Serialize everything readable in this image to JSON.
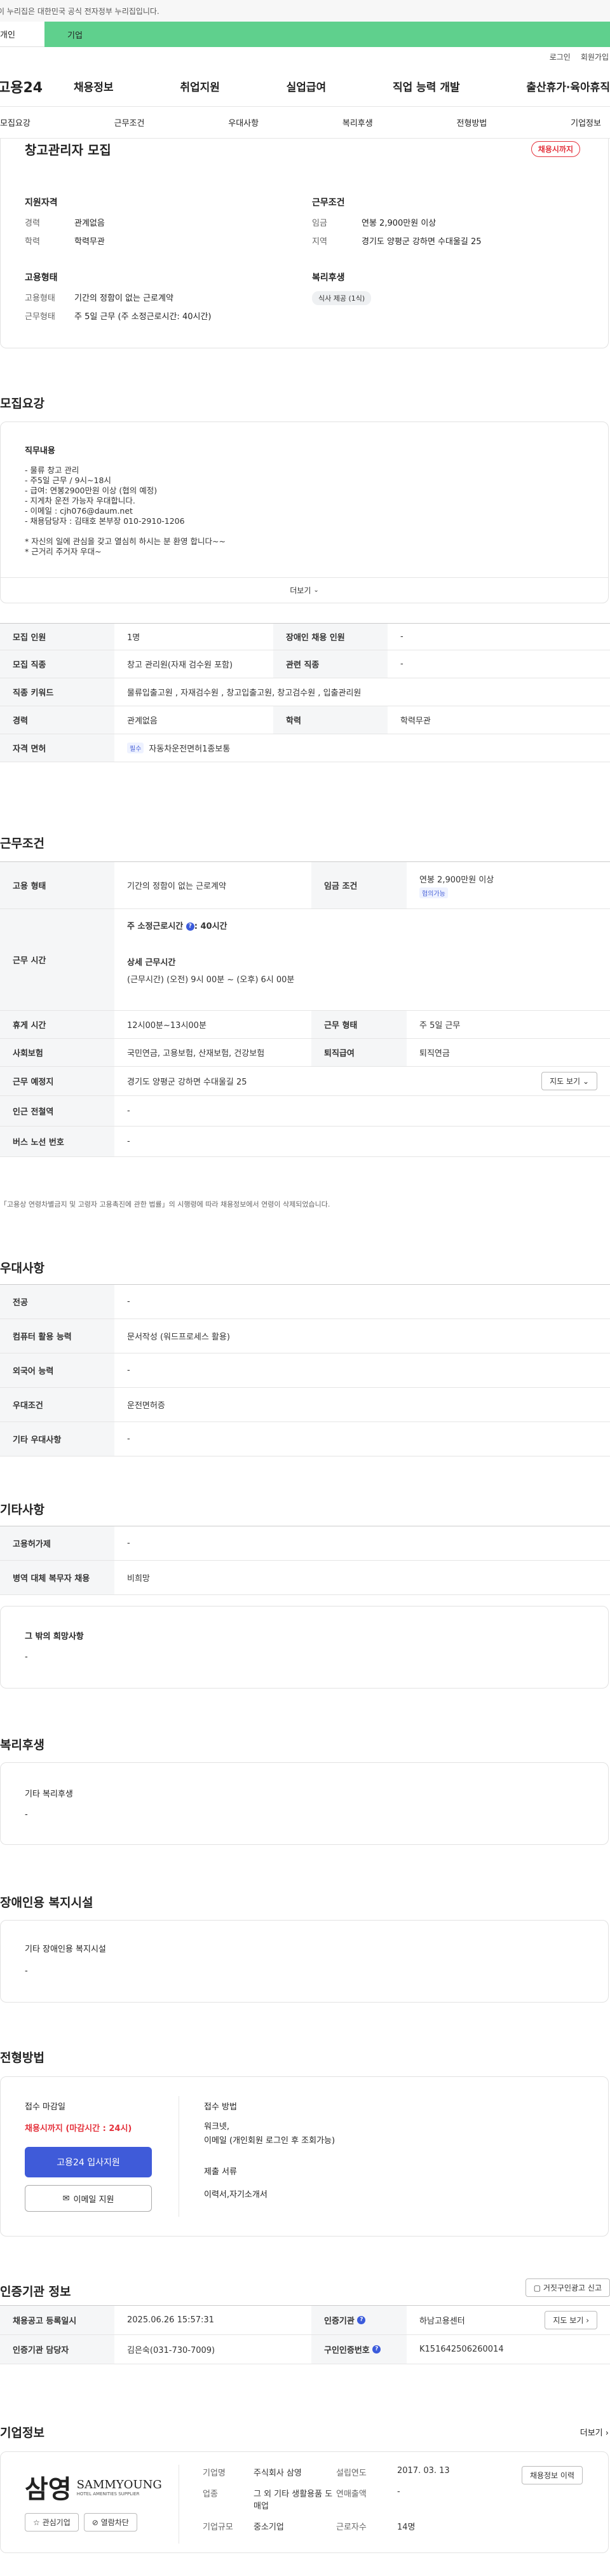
{
  "gov_banner": "이 누리집은 대한민국 공식 전자정부 누리집입니다.",
  "top_tabs": [
    "개인",
    "기업"
  ],
  "util": [
    "로그인",
    "회원가입"
  ],
  "logo": "고용24",
  "gnb": [
    "채용정보",
    "취업지원",
    "실업급여",
    "직업 능력 개발",
    "출산휴가·육아휴직"
  ],
  "subnav": [
    "모집요강",
    "근무조건",
    "우대사항",
    "복리후생",
    "전형방법",
    "기업정보"
  ],
  "summary": {
    "title": "창고관리자 모집",
    "status_badge": "채용시까지",
    "qualification": {
      "heading": "지원자격",
      "career_k": "경력",
      "career_v": "관계없음",
      "edu_k": "학력",
      "edu_v": "학력무관"
    },
    "employment": {
      "heading": "고용형태",
      "type_k": "고용형태",
      "type_v": "기간의 정함이 없는 근로계약",
      "hours_k": "근무형태",
      "hours_v": "주 5일 근무 (주 소정근로시간: 40시간)"
    },
    "conditions": {
      "heading": "근무조건",
      "wage_k": "임금",
      "wage_v": "연봉 2,900만원 이상",
      "loc_k": "지역",
      "loc_v": "경기도 양평군 강하면 수대울길 25"
    },
    "welfare": {
      "heading": "복리후생",
      "pill": "식사 제공 (1식)"
    }
  },
  "recruit": {
    "title": "모집요강",
    "duty_heading": "직무내용",
    "duty_lines": [
      "- 물류 창고 관리",
      "- 주5일 근무 / 9시~18시",
      "- 급여: 연봉2900만원 이상 (협의 예정)",
      "- 지게차 운전 가능자 우대합니다.",
      "- 이메일 : cjh076@daum.net",
      "- 채용담당자 : 김태호 본부장  010-2910-1206",
      "",
      "* 자신의 일에 관심을 갖고 열심히 하시는 분 환영 합니다~~",
      "* 근거리 주거자 우대~"
    ],
    "more": "더보기",
    "rows": [
      {
        "k1": "모집 인원",
        "v1": "1명",
        "k2": "장애인 채용 인원",
        "v2": "-"
      },
      {
        "k1": "모집 직종",
        "v1": "창고 관리원(자재 검수원 포함)",
        "k2": "관련 직종",
        "v2": "-"
      },
      {
        "k1": "직종 키워드",
        "v1": "물류입출고원 , 자재검수원 , 창고입출고원, 창고검수원 , 입출관리원"
      },
      {
        "k1": "경력",
        "v1": "관계없음",
        "k2": "학력",
        "v2": "학력무관"
      },
      {
        "k1": "자격 면허",
        "tag": "필수",
        "v1": "자동차운전면허1종보통"
      }
    ]
  },
  "work": {
    "title": "근무조건",
    "type_k": "고용 형태",
    "type_v": "기간의 정함이 없는 근로계약",
    "wage_k": "임금 조건",
    "wage_v": "연봉 2,900만원 이상",
    "wage_tag": "협의가능",
    "time_k": "근무 시간",
    "time_l1": "주 소정근로시간",
    "time_l1b": ": 40시간",
    "time_l2": "상세 근무시간",
    "time_l3": "(근무시간) (오전) 9시 00분 ~ (오후) 6시 00분",
    "rest_k": "휴게 시간",
    "rest_v": "12시00분~13시00분",
    "form_k": "근무 형태",
    "form_v": "주 5일 근무",
    "ins_k": "사회보험",
    "ins_v": "국민연금, 고용보험, 산재보험, 건강보험",
    "ret_k": "퇴직급여",
    "ret_v": "퇴직연금",
    "place_k": "근무 예정지",
    "place_v": "경기도 양평군 강하면 수대울길 25",
    "map_btn": "지도 보기",
    "sub_k": "인근 전철역",
    "sub_v": "-",
    "bus_k": "버스 노선 번호",
    "bus_v": "-",
    "note": "「고용상 연령차별금지 및 고령자 고용촉진에 관한 법률」의 시행령에 따라 채용정보에서 연령이 삭제되었습니다."
  },
  "pref": {
    "title": "우대사항",
    "rows": [
      {
        "k": "전공",
        "v": "-"
      },
      {
        "k": "컴퓨터 활용 능력",
        "v": "문서작성 (워드프로세스 활용)"
      },
      {
        "k": "외국어 능력",
        "v": "-"
      },
      {
        "k": "우대조건",
        "v": "운전면허증"
      },
      {
        "k": "기타 우대사항",
        "v": "-"
      }
    ]
  },
  "etc": {
    "title": "기타사항",
    "rows": [
      {
        "k": "고용허가제",
        "v": "-"
      },
      {
        "k": "병역 대체 복무자 채용",
        "v": "비희망"
      }
    ],
    "other_heading": "그 밖의 희망사항",
    "other_v": "-"
  },
  "welfare": {
    "title": "복리후생",
    "heading": "기타 복리후생",
    "v": "-"
  },
  "disability": {
    "title": "장애인용 복지시설",
    "heading": "기타 장애인용 복지시설",
    "v": "-"
  },
  "process": {
    "title": "전형방법",
    "deadline_heading": "접수 마감일",
    "deadline_v": "채용시까지 (마감시간 : 24시)",
    "apply_btn": "고용24 입사지원",
    "email_btn": "이메일 지원",
    "method_heading": "접수 방법",
    "method_l1": "워크넷,",
    "method_l2": "이메일 (개인회원 로그인 후 조회가능)",
    "docs_heading": "제출 서류",
    "docs_v": "이력서,자기소개서"
  },
  "agency": {
    "title": "인증기관 정보",
    "report_btn": "거짓구인광고 신고",
    "reg_k": "채용공고 등록일시",
    "reg_v": "2025.06.26 15:57:31",
    "org_k": "인증기관",
    "org_v": "하남고용센터",
    "map_btn": "지도 보기",
    "mgr_k": "인증기관 담당자",
    "mgr_v": "김은숙(031-730-7009)",
    "num_k": "구인인증번호",
    "num_v": "K151642506260014"
  },
  "company": {
    "title": "기업정보",
    "more": "더보기",
    "logo_big": "삼영",
    "logo_en": "SAMMYOUNG",
    "logo_sub": "HOTEL AMENITIES SUPPLIER",
    "fav_btn": "관심기업",
    "block_btn": "열람차단",
    "name_k": "기업명",
    "name_v": "주식회사 삼영",
    "ind_k": "업종",
    "ind_v": "그 외 기타 생활용품 도매업",
    "size_k": "기업규모",
    "size_v": "중소기업",
    "est_k": "설립연도",
    "est_v": "2017. 03. 13",
    "rev_k": "연매출액",
    "rev_v": "-",
    "emp_k": "근로자수",
    "emp_v": "14명",
    "jobs_btn": "채용정보 이력"
  }
}
